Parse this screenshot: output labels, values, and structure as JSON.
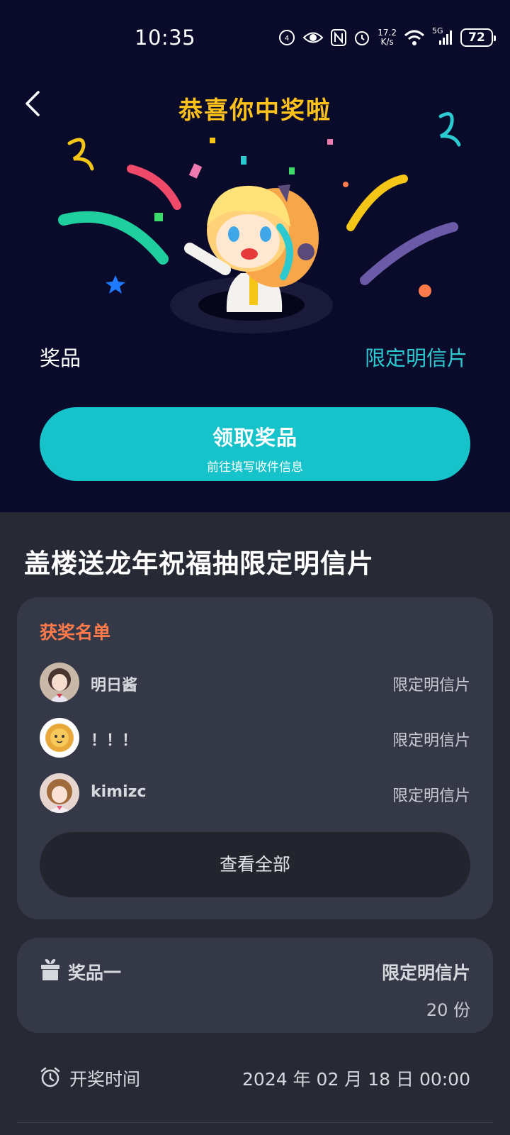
{
  "status_bar": {
    "time": "10:35",
    "net_speed_value": "17.2",
    "net_speed_unit": "K/s",
    "network_type": "5G",
    "battery": "72"
  },
  "hero": {
    "title": "恭喜你中奖啦",
    "prize_label": "奖品",
    "prize_value": "限定明信片",
    "claim_button": {
      "label": "领取奖品",
      "sublabel": "前往填写收件信息"
    },
    "colors": {
      "background": "#0a0a2a",
      "title": "#ffc21a",
      "accent": "#16c3cb"
    }
  },
  "event": {
    "title": "盖楼送龙年祝福抽限定明信片"
  },
  "winners": {
    "heading": "获奖名单",
    "items": [
      {
        "name": "明日酱",
        "prize": "限定明信片",
        "avatar": "anime-girl-avatar"
      },
      {
        "name": "！！！",
        "prize": "限定明信片",
        "avatar": "lion-avatar"
      },
      {
        "name": "kimizc",
        "prize": "限定明信片",
        "avatar": "anime-girl-avatar"
      }
    ],
    "view_all_label": "查看全部"
  },
  "prize_info": {
    "name": "奖品一",
    "value": "限定明信片",
    "count": "20 份",
    "icon": "gift-icon"
  },
  "draw_time": {
    "label": "开奖时间",
    "value": "2024 年 02 月 18 日 00:00",
    "icon": "clock-icon"
  }
}
